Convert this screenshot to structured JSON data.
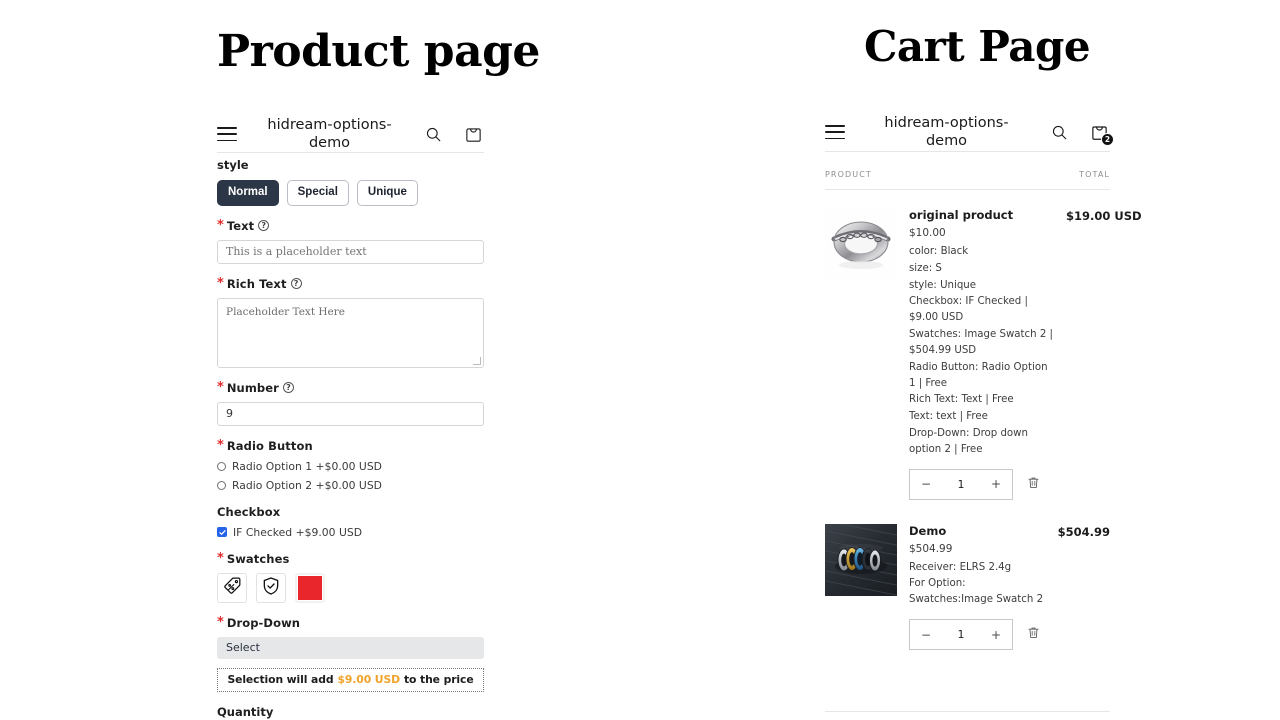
{
  "page": {
    "product_heading": "Product page",
    "cart_heading": "Cart Page"
  },
  "colors": {
    "accent_selected": "#2b3647",
    "red_swatch": "#e8262c",
    "checkbox_blue": "#2563eb",
    "price_amount_orange": "#f0a32a",
    "required_red": "#e02b2b"
  },
  "store_header": {
    "menu_icon": "hamburger-icon",
    "store_name": "hidream-options-demo",
    "search_icon": "search-icon",
    "bag_icon": "shopping-bag-icon",
    "cart_count": "2"
  },
  "product_form": {
    "style": {
      "label": "style",
      "options": [
        {
          "label": "Normal",
          "selected": true
        },
        {
          "label": "Special",
          "selected": false
        },
        {
          "label": "Unique",
          "selected": false
        }
      ]
    },
    "text_field": {
      "label": "Text",
      "required": true,
      "help_icon": "question-mark-icon",
      "placeholder": "This is a placeholder text",
      "value": ""
    },
    "rich_text_field": {
      "label": "Rich Text",
      "required": true,
      "help_icon": "question-mark-icon",
      "placeholder": "Placeholder Text Here",
      "value": ""
    },
    "number_field": {
      "label": "Number",
      "required": true,
      "help_icon": "question-mark-icon",
      "value": "9"
    },
    "radio_group": {
      "label": "Radio Button",
      "required": true,
      "options": [
        {
          "label": "Radio Option 1 +$0.00 USD",
          "checked": false
        },
        {
          "label": "Radio Option 2 +$0.00 USD",
          "checked": false
        }
      ]
    },
    "checkbox_group": {
      "label": "Checkbox",
      "required": false,
      "options": [
        {
          "label": "IF Checked +$9.00 USD",
          "checked": true
        }
      ]
    },
    "swatches": {
      "label": "Swatches",
      "required": true,
      "items": [
        {
          "type": "image",
          "icon": "price-tag-percent-icon"
        },
        {
          "type": "image",
          "icon": "shield-check-icon"
        },
        {
          "type": "color",
          "color": "#e8262c"
        }
      ]
    },
    "dropdown": {
      "label": "Drop-Down",
      "required": true,
      "selected": "Select"
    },
    "price_note": {
      "prefix": "Selection will add",
      "amount": "$9.00 USD",
      "suffix": "to the price"
    },
    "quantity_label": "Quantity"
  },
  "cart": {
    "columns": {
      "product": "PRODUCT",
      "total": "TOTAL"
    },
    "items": [
      {
        "thumb": "silver-chain-ring-image",
        "name": "original product",
        "unit_price": "$10.00",
        "total": "$19.00",
        "total_currency": "USD",
        "options": [
          "color: Black",
          "size: S",
          "style: Unique",
          "Checkbox: IF Checked | $9.00 USD",
          "Swatches: Image Swatch 2 | $504.99 USD",
          "Radio Button: Radio Option 1 | Free",
          "Rich Text: Text | Free",
          "Text: text | Free",
          "Drop-Down: Drop down option 2 | Free"
        ],
        "quantity": "1",
        "decrement": "−",
        "increment": "+",
        "remove_icon": "trash-icon"
      },
      {
        "thumb": "rings-on-dark-wood-image",
        "name": "Demo",
        "unit_price": "$504.99",
        "total": "$504.99",
        "total_currency": "",
        "options": [
          "Receiver: ELRS 2.4g",
          "For Option: Swatches:Image Swatch 2"
        ],
        "quantity": "1",
        "decrement": "−",
        "increment": "+",
        "remove_icon": "trash-icon"
      }
    ]
  }
}
